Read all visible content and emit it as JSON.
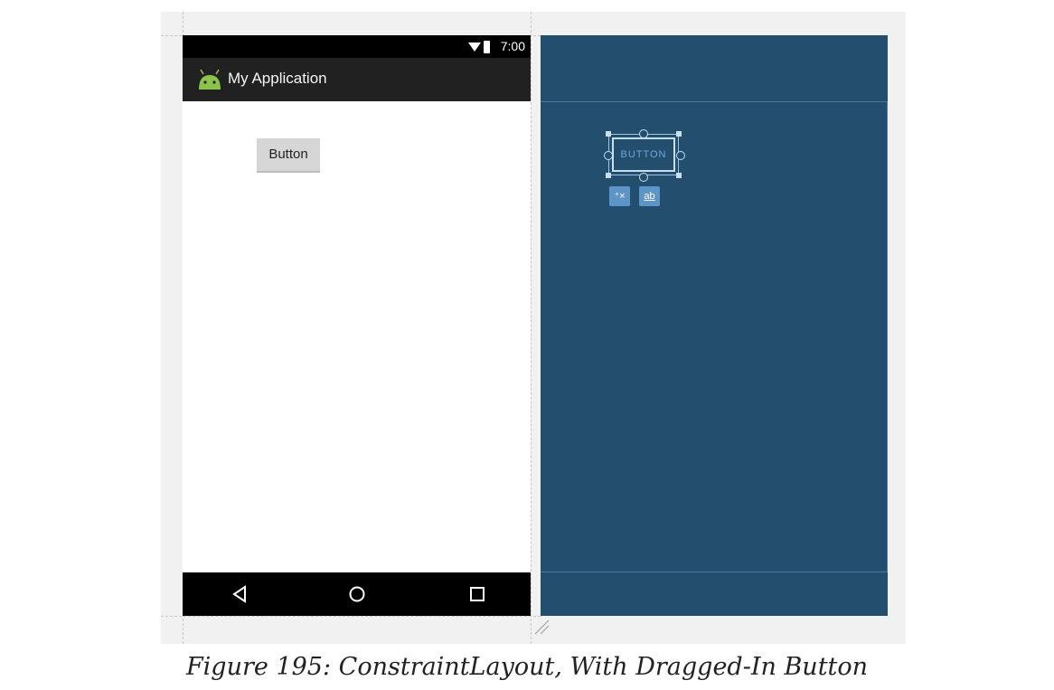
{
  "status_bar": {
    "time": "7:00"
  },
  "action_bar": {
    "title": "My Application"
  },
  "preview": {
    "button_label": "Button"
  },
  "blueprint": {
    "button_label": "BUTTON",
    "tool_clear_label": "⁺×",
    "tool_baseline_label": "ab"
  },
  "caption": "Figure 195: ConstraintLayout, With Dragged-In Button",
  "colors": {
    "blueprint_bg": "#234e6e",
    "actionbar_bg": "#212121",
    "android_green": "#8bc34a"
  },
  "icons": [
    "wifi-icon",
    "battery-icon",
    "android-logo-icon",
    "back-nav-icon",
    "home-nav-icon",
    "recents-nav-icon",
    "clear-constraints-icon",
    "baseline-icon",
    "resize-handle-icon"
  ]
}
